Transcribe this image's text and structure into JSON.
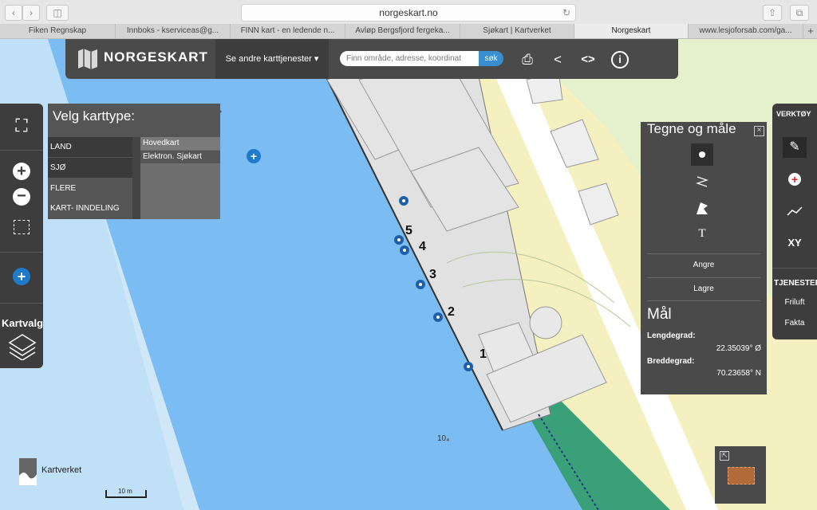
{
  "browser": {
    "url": "norgeskart.no",
    "tabs": [
      "Fiken Regnskap",
      "Innboks - kserviceas@g...",
      "FINN kart - en ledende n...",
      "Avløp Bergsfjord fergeka...",
      "Sjøkart | Kartverket",
      "Norgeskart",
      "www.lesjoforsab.com/ga..."
    ],
    "active_tab": "Norgeskart"
  },
  "toolbar": {
    "logo": "NORGESKART",
    "services": "Se andre karttjenester ▾",
    "search_placeholder": "Finn område, adresse, koordinat",
    "search_button": "søk"
  },
  "karttype": {
    "title": "Velg karttype:",
    "items": [
      "LAND",
      "SJØ",
      "FLERE",
      "KART- INNDELING"
    ],
    "sub_items": [
      "Hovedkart",
      "Elektron. Sjøkart"
    ]
  },
  "left_tools": {
    "kartvalg": "Kartvalg"
  },
  "tegne": {
    "title": "Tegne og måle",
    "close": "×",
    "undo": "Angre",
    "save": "Lagre",
    "maal_title": "Mål",
    "lng_label": "Lengdegrad:",
    "lng_value": "22.35039° Ø",
    "lat_label": "Breddegrad:",
    "lat_value": "70.23658° N"
  },
  "right_tools": {
    "title": "VERKTØY",
    "xy": "XY",
    "services_title": "TJENESTER",
    "friluft": "Friluft",
    "fakta": "Fakta"
  },
  "map": {
    "markers": [
      "1",
      "2",
      "3",
      "4",
      "5"
    ],
    "depth": "10₄",
    "scale": "10 m",
    "brand": "Kartverket"
  },
  "colors": {
    "sea_deep": "#7bbcf2",
    "sea_light": "#cfe7f7",
    "land_yellow": "#f5f0c0",
    "quay_grey": "#e1e1e1",
    "accent_blue": "#1f5fa8",
    "panel_dark": "#4a4a4a"
  }
}
